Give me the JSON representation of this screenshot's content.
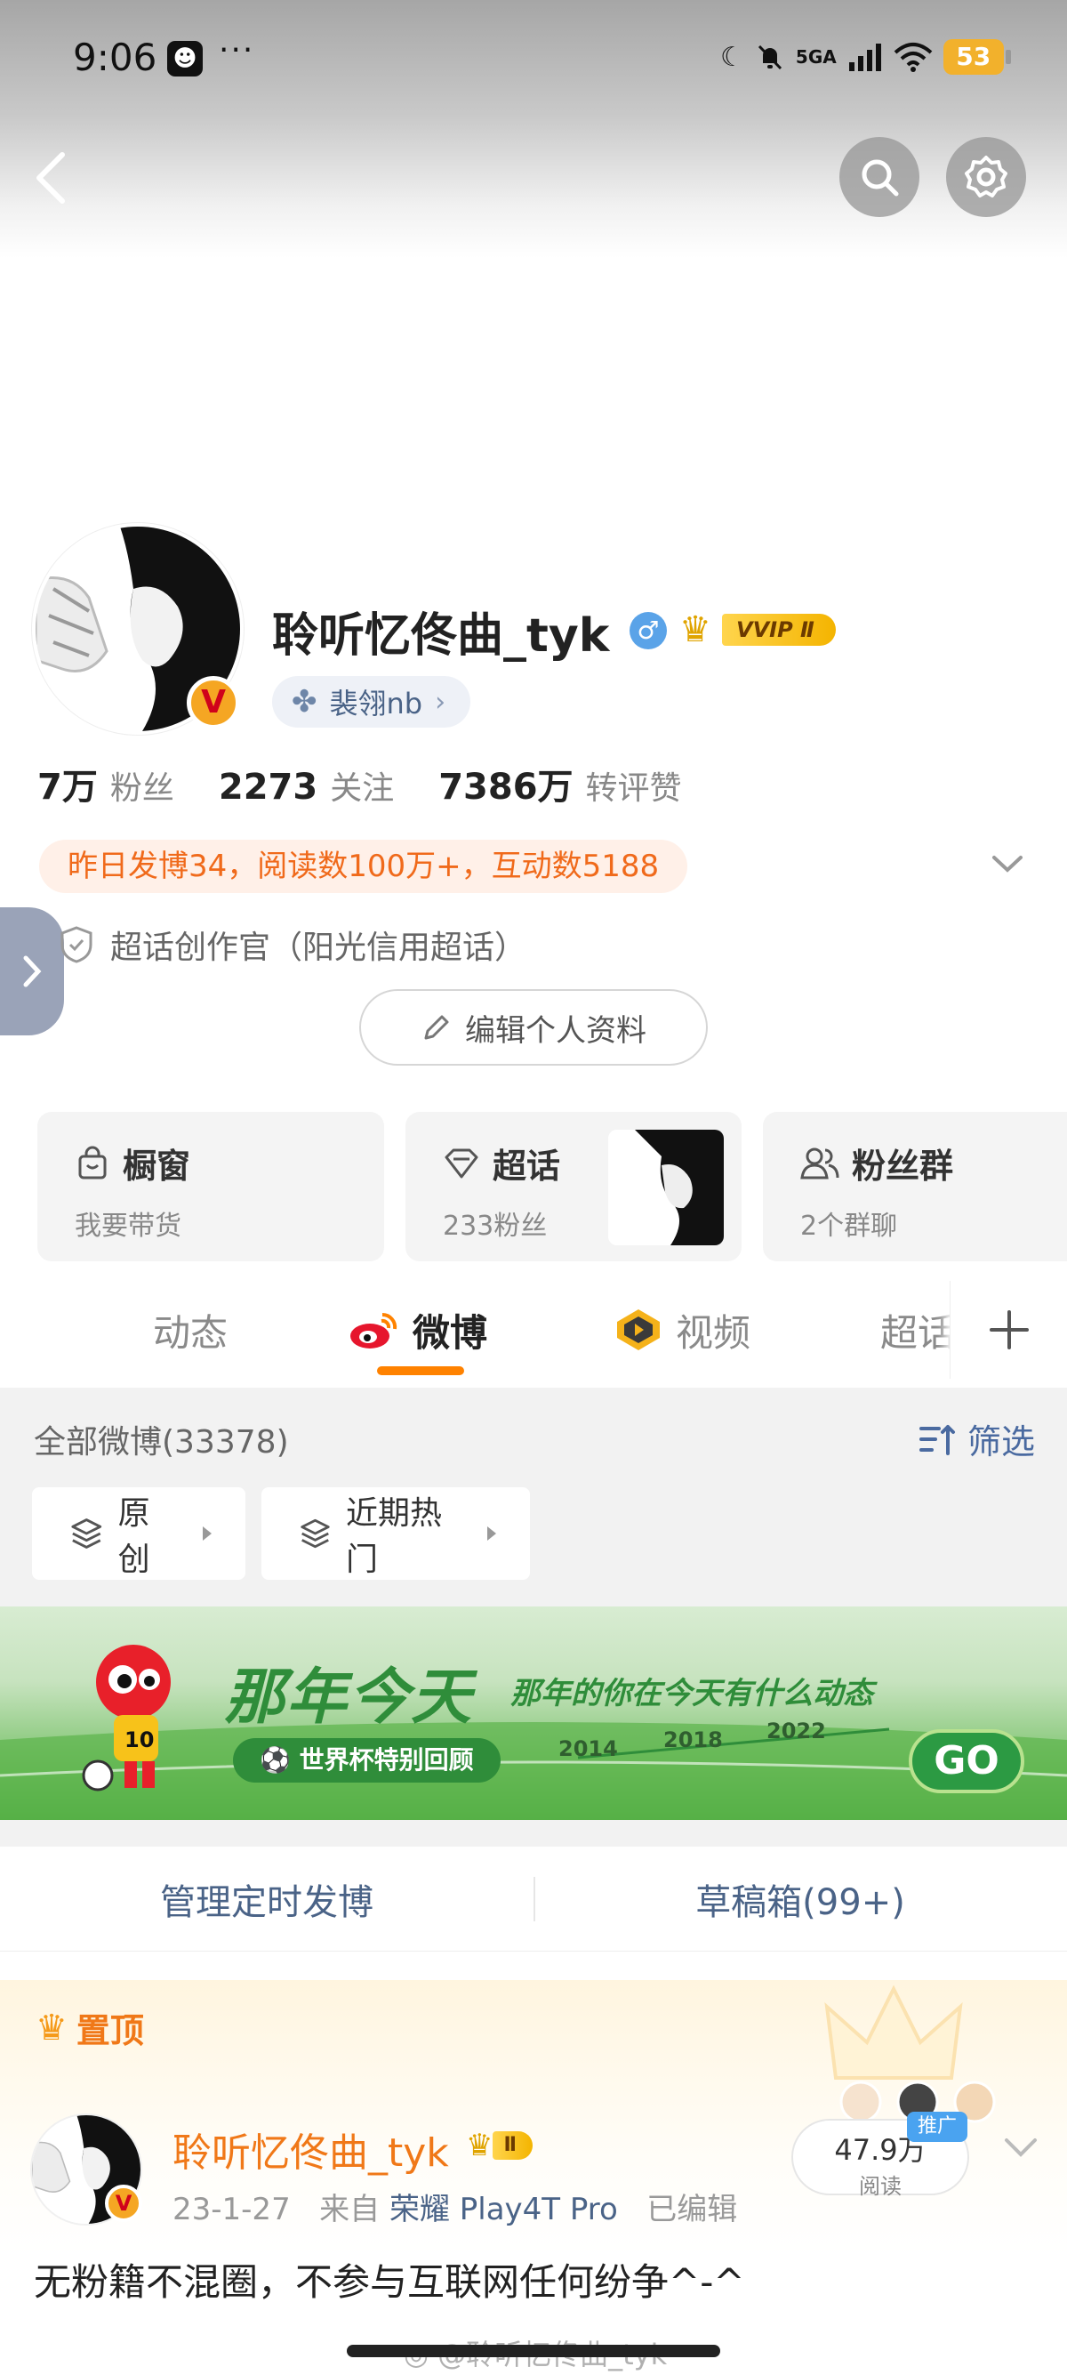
{
  "status_bar": {
    "time": "9:06",
    "dots": "···",
    "network": "5GA",
    "battery": "53"
  },
  "profile": {
    "username": "聆听忆佟曲_tyk",
    "gender_icon": "male",
    "vip_label": "VVIP Ⅱ",
    "group": "裴翎nb",
    "stats": [
      {
        "value": "7万",
        "label": "粉丝"
      },
      {
        "value": "2273",
        "label": "关注"
      },
      {
        "value": "7386万",
        "label": "转评赞"
      }
    ],
    "highlight": "昨日发博34，阅读数100万+，互动数5188",
    "supertopic_role": "超话创作官（阳光信用超话）",
    "edit_button": "编辑个人资料"
  },
  "cards": [
    {
      "title": "橱窗",
      "sub": "我要带货",
      "icon": "bag-icon"
    },
    {
      "title": "超话",
      "sub": "233粉丝",
      "icon": "diamond-icon"
    },
    {
      "title": "粉丝群",
      "sub": "2个群聊",
      "icon": "people-icon"
    }
  ],
  "tabs": [
    "动态",
    "微博",
    "视频",
    "超话"
  ],
  "posts_header": {
    "all_posts": "全部微博(33378)",
    "filter": "筛选",
    "chips": [
      "原创",
      "近期热门"
    ]
  },
  "banner": {
    "title": "那年今天",
    "slogan": "那年的你在今天有什么动态",
    "tag": "世界杯特别回顾",
    "years": [
      "2014",
      "2018",
      "2022"
    ],
    "go": "GO"
  },
  "manage": {
    "scheduled": "管理定时发博",
    "drafts": "草稿箱(99+)"
  },
  "pinned_post": {
    "pin_label": "置顶",
    "name": "聆听忆佟曲_tyk",
    "vip_label": "Ⅱ",
    "date": "23-1-27",
    "from": "来自",
    "device": "荣耀 Play4T Pro",
    "edited": "已编辑",
    "reads": "47.9万",
    "reads_label": "阅读",
    "promo": "推广",
    "text": "无粉籍不混圈，不参与互联网任何纷争^-^"
  },
  "watermark": "@聆听忆佟曲_tyk",
  "colors": {
    "accent": "#ff8200",
    "link": "#4a6387",
    "highlight_text": "#f06a1b"
  }
}
